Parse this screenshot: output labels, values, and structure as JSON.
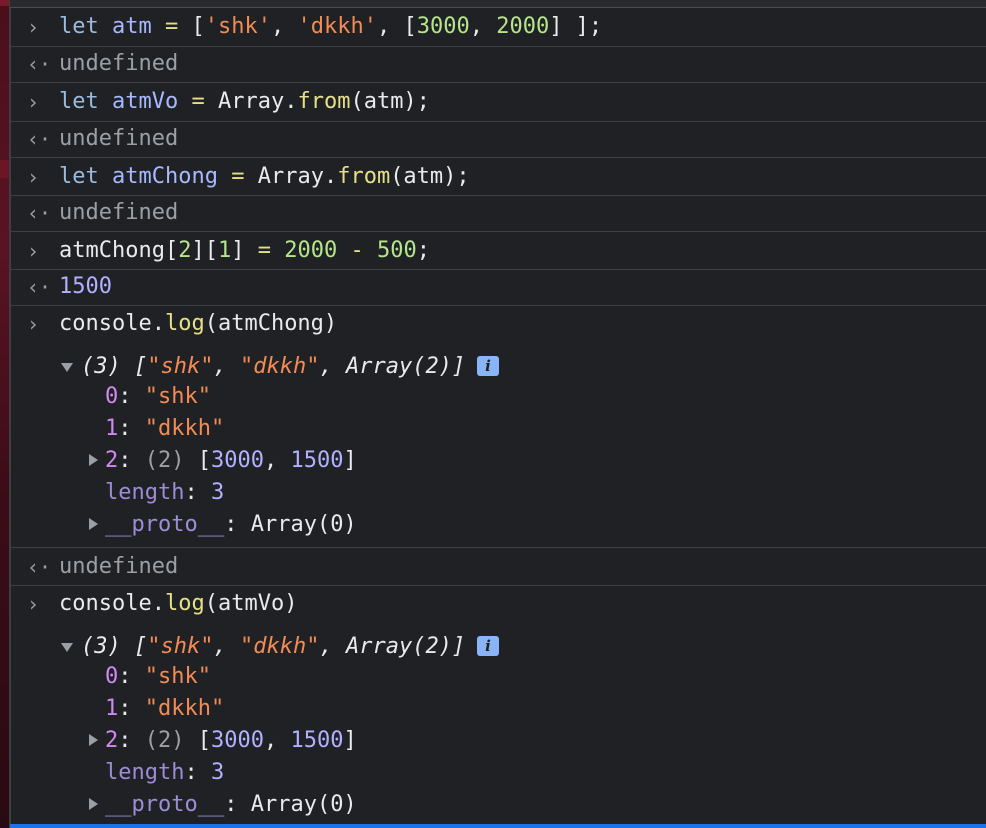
{
  "entries": [
    {
      "type": "input",
      "tokens": [
        "let",
        " ",
        "atm",
        " ",
        "=",
        " ",
        "[",
        "'shk'",
        ", ",
        "'dkkh'",
        ", ",
        "[",
        "3000",
        ", ",
        "2000",
        "]",
        " ];"
      ]
    },
    {
      "type": "output",
      "text": "undefined"
    },
    {
      "type": "input",
      "tokens": [
        "let",
        " ",
        "atmVo",
        " ",
        "=",
        " ",
        "Array.",
        "from",
        "(atm);"
      ]
    },
    {
      "type": "output",
      "text": "undefined"
    },
    {
      "type": "input",
      "tokens": [
        "let",
        " ",
        "atmChong",
        " ",
        "=",
        " ",
        "Array.",
        "from",
        "(atm);"
      ]
    },
    {
      "type": "output",
      "text": "undefined"
    },
    {
      "type": "input",
      "tokens": [
        "atmChong[",
        "2",
        "][",
        "1",
        "] ",
        "=",
        " ",
        "2000",
        " ",
        "-",
        " ",
        "500",
        ";"
      ]
    },
    {
      "type": "output",
      "text": "1500"
    },
    {
      "type": "input",
      "tokens": [
        "console.",
        "log",
        "(atmChong)"
      ]
    },
    {
      "type": "output",
      "text": "undefined"
    },
    {
      "type": "input",
      "tokens": [
        "console.",
        "log",
        "(atmVo)"
      ]
    }
  ],
  "log_blocks": [
    {
      "summary": {
        "count": "(3)",
        "items": [
          "[",
          "\"shk\"",
          ", ",
          "\"dkkh\"",
          ", ",
          "Array(2)",
          "]"
        ]
      },
      "info_badge": "i",
      "props": [
        {
          "key": "0",
          "value": "\"shk\""
        },
        {
          "key": "1",
          "value": "\"dkkh\""
        }
      ],
      "nested": {
        "key": "2",
        "count": "(2)",
        "open": "[",
        "v1": "3000",
        "sep": ", ",
        "v2": "1500",
        "close": "]"
      },
      "length": {
        "key": "length",
        "value": "3"
      },
      "proto": {
        "key": "__proto__",
        "value": "Array(0)"
      }
    },
    {
      "summary": {
        "count": "(3)",
        "items": [
          "[",
          "\"shk\"",
          ", ",
          "\"dkkh\"",
          ", ",
          "Array(2)",
          "]"
        ]
      },
      "info_badge": "i",
      "props": [
        {
          "key": "0",
          "value": "\"shk\""
        },
        {
          "key": "1",
          "value": "\"dkkh\""
        }
      ],
      "nested": {
        "key": "2",
        "count": "(2)",
        "open": "[",
        "v1": "3000",
        "sep": ", ",
        "v2": "1500",
        "close": "]"
      },
      "length": {
        "key": "length",
        "value": "3"
      },
      "proto": {
        "key": "__proto__",
        "value": "Array(0)"
      }
    }
  ],
  "icons": {
    "input_prompt": "chevron-right-icon",
    "output_return": "return-arrow-icon"
  },
  "colors": {
    "background": "#202124",
    "keyword": "#9bbbdc",
    "variable": "#a6b9ff",
    "function": "#e5e087",
    "string": "#f28b54",
    "number_literal": "#b5e48c",
    "number_value": "#b2b0ff",
    "property_key": "#cf8aef",
    "accent": "#1a73e8"
  }
}
